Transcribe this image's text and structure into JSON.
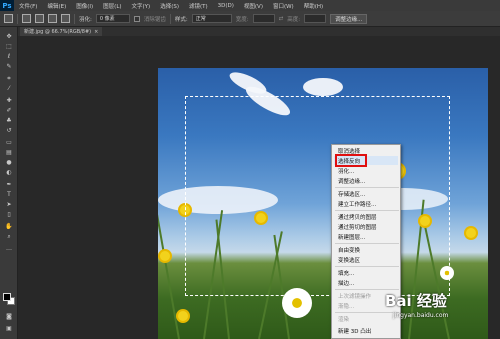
{
  "app": {
    "logo": "Ps"
  },
  "menubar": {
    "items": [
      "文件(F)",
      "编辑(E)",
      "图像(I)",
      "图层(L)",
      "文字(Y)",
      "选择(S)",
      "滤镜(T)",
      "3D(D)",
      "视图(V)",
      "窗口(W)",
      "帮助(H)"
    ]
  },
  "options": {
    "feather_label": "羽化:",
    "feather_value": "0 像素",
    "antialias_label": "消除锯齿",
    "style_label": "样式:",
    "style_value": "正常",
    "width_label": "宽度:",
    "height_label": "高度:",
    "refine_button": "调整边缘..."
  },
  "document": {
    "tab_label": "新建.jpg @ 66.7%(RGB/8#)",
    "close": "×"
  },
  "context_menu": {
    "items": [
      {
        "label": "取消选择",
        "disabled": false
      },
      {
        "label": "选择反向",
        "disabled": false,
        "highlighted": true
      },
      {
        "label": "羽化...",
        "disabled": false
      },
      {
        "label": "调整边缘...",
        "disabled": false
      },
      {
        "label": "存储选区...",
        "disabled": false
      },
      {
        "label": "建立工作路径...",
        "disabled": false
      },
      {
        "label": "通过拷贝的图层",
        "disabled": false
      },
      {
        "label": "通过剪切的图层",
        "disabled": false
      },
      {
        "label": "新建图层...",
        "disabled": false
      },
      {
        "label": "自由变换",
        "disabled": false
      },
      {
        "label": "变换选区",
        "disabled": false
      },
      {
        "label": "填充...",
        "disabled": false
      },
      {
        "label": "描边...",
        "disabled": false
      },
      {
        "label": "上次滤镜操作",
        "disabled": true
      },
      {
        "label": "渐隐...",
        "disabled": true
      },
      {
        "label": "渲染",
        "disabled": true
      },
      {
        "label": "新建 3D 凸出",
        "disabled": false
      }
    ]
  },
  "watermark": {
    "logo": "Bai 经验",
    "url": "jingyan.baidu.com"
  },
  "colors": {
    "menubar": "#3a3a3a",
    "workspace": "#282828",
    "highlight_box": "#e01010"
  }
}
